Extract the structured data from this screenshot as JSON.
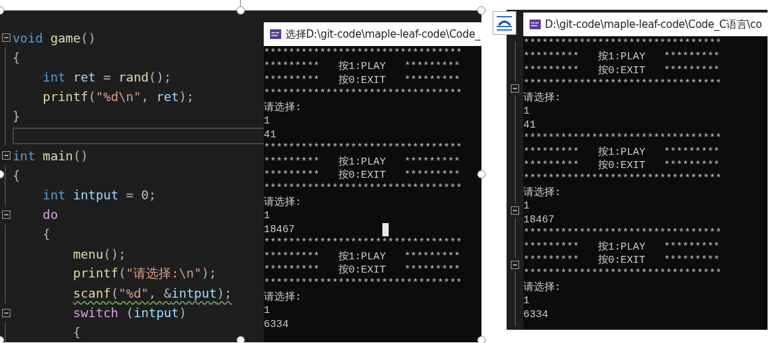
{
  "editor": {
    "lines": [
      {
        "collapsible": true,
        "current": false,
        "warning": false,
        "tokens": [
          {
            "text": "void",
            "kind": "type"
          },
          {
            "text": " game",
            "kind": "func"
          },
          {
            "text": "()",
            "kind": "punct"
          }
        ]
      },
      {
        "collapsible": false,
        "current": false,
        "warning": false,
        "tokens": [
          {
            "text": "{",
            "kind": "punct"
          }
        ]
      },
      {
        "collapsible": false,
        "current": false,
        "warning": false,
        "tokens": [
          {
            "text": "    int",
            "kind": "type"
          },
          {
            "text": " ret",
            "kind": "ident"
          },
          {
            "text": " = ",
            "kind": "punct"
          },
          {
            "text": "rand",
            "kind": "func"
          },
          {
            "text": "();",
            "kind": "punct"
          }
        ]
      },
      {
        "collapsible": false,
        "current": false,
        "warning": false,
        "tokens": [
          {
            "text": "    printf",
            "kind": "func"
          },
          {
            "text": "(",
            "kind": "punct"
          },
          {
            "text": "\"%d\\n\"",
            "kind": "string"
          },
          {
            "text": ", ",
            "kind": "punct"
          },
          {
            "text": "ret",
            "kind": "ident"
          },
          {
            "text": ");",
            "kind": "punct"
          }
        ]
      },
      {
        "collapsible": false,
        "current": false,
        "warning": false,
        "tokens": [
          {
            "text": "}",
            "kind": "punct"
          }
        ]
      },
      {
        "collapsible": false,
        "current": true,
        "warning": false
      },
      {
        "collapsible": true,
        "current": false,
        "warning": false,
        "tokens": [
          {
            "text": "int",
            "kind": "type"
          },
          {
            "text": " main",
            "kind": "func"
          },
          {
            "text": "()",
            "kind": "punct"
          }
        ]
      },
      {
        "collapsible": false,
        "current": false,
        "warning": false,
        "tokens": [
          {
            "text": "{",
            "kind": "punct"
          }
        ]
      },
      {
        "collapsible": false,
        "current": false,
        "warning": false,
        "tokens": [
          {
            "text": "    int",
            "kind": "type"
          },
          {
            "text": " intput",
            "kind": "ident"
          },
          {
            "text": " = ",
            "kind": "punct"
          },
          {
            "text": "0",
            "kind": "number"
          },
          {
            "text": ";",
            "kind": "punct"
          }
        ]
      },
      {
        "collapsible": true,
        "current": false,
        "warning": false,
        "tokens": [
          {
            "text": "    do",
            "kind": "control"
          }
        ]
      },
      {
        "collapsible": false,
        "current": false,
        "warning": false,
        "tokens": [
          {
            "text": "    {",
            "kind": "punct"
          }
        ]
      },
      {
        "collapsible": false,
        "current": false,
        "warning": false,
        "tokens": [
          {
            "text": "        menu",
            "kind": "func"
          },
          {
            "text": "();",
            "kind": "punct"
          }
        ]
      },
      {
        "collapsible": false,
        "current": false,
        "warning": false,
        "tokens": [
          {
            "text": "        printf",
            "kind": "func"
          },
          {
            "text": "(",
            "kind": "punct"
          },
          {
            "text": "\"请选择:\\n\"",
            "kind": "string"
          },
          {
            "text": ");",
            "kind": "punct"
          }
        ]
      },
      {
        "collapsible": false,
        "current": false,
        "warning": true,
        "tokens": [
          {
            "text": "        scanf",
            "kind": "func"
          },
          {
            "text": "(",
            "kind": "punct"
          },
          {
            "text": "\"%d\"",
            "kind": "string"
          },
          {
            "text": ", &",
            "kind": "punct"
          },
          {
            "text": "intput",
            "kind": "ident"
          },
          {
            "text": ");",
            "kind": "punct"
          }
        ]
      },
      {
        "collapsible": true,
        "current": false,
        "warning": false,
        "tokens": [
          {
            "text": "        switch",
            "kind": "control"
          },
          {
            "text": " (",
            "kind": "punct"
          },
          {
            "text": "intput",
            "kind": "ident"
          },
          {
            "text": ")",
            "kind": "punct"
          }
        ]
      },
      {
        "collapsible": false,
        "current": false,
        "warning": false,
        "tokens": [
          {
            "text": "        {",
            "kind": "punct"
          }
        ]
      }
    ]
  },
  "console_left": {
    "title": "选择D:\\git-code\\maple-leaf-code\\Code_",
    "lines": [
      {
        "text": "********************************",
        "cursor": false
      },
      {
        "text": "*********   按1:PLAY   *********",
        "cursor": false
      },
      {
        "text": "*********   按0:EXIT   *********",
        "cursor": false
      },
      {
        "text": "********************************",
        "cursor": false
      },
      {
        "text": "请选择:",
        "cursor": false
      },
      {
        "text": "1",
        "cursor": false
      },
      {
        "text": "41",
        "cursor": false
      },
      {
        "text": "********************************",
        "cursor": false
      },
      {
        "text": "*********   按1:PLAY   *********",
        "cursor": false
      },
      {
        "text": "*********   按0:EXIT   *********",
        "cursor": false
      },
      {
        "text": "********************************",
        "cursor": false
      },
      {
        "text": "请选择:",
        "cursor": false
      },
      {
        "text": "1",
        "cursor": false
      },
      {
        "text": "18467",
        "cursor": true
      },
      {
        "text": "********************************",
        "cursor": false
      },
      {
        "text": "*********   按1:PLAY   *********",
        "cursor": false
      },
      {
        "text": "*********   按0:EXIT   *********",
        "cursor": false
      },
      {
        "text": "********************************",
        "cursor": false
      },
      {
        "text": "请选择:",
        "cursor": false
      },
      {
        "text": "1",
        "cursor": false
      },
      {
        "text": "6334",
        "cursor": false
      }
    ]
  },
  "console_right": {
    "title": "D:\\git-code\\maple-leaf-code\\Code_C语言\\co",
    "lines": [
      {
        "text": "********************************",
        "gutter_fold": false
      },
      {
        "text": "*********   按1:PLAY   *********",
        "gutter_fold": false
      },
      {
        "text": "*********   按0:EXIT   *********",
        "gutter_fold": false
      },
      {
        "text": "********************************",
        "gutter_fold": true
      },
      {
        "text": "请选择:",
        "gutter_fold": false
      },
      {
        "text": "1",
        "gutter_fold": false
      },
      {
        "text": "41",
        "gutter_fold": false
      },
      {
        "text": "********************************",
        "gutter_fold": false
      },
      {
        "text": "*********   按1:PLAY   *********",
        "gutter_fold": false
      },
      {
        "text": "*********   按0:EXIT   *********",
        "gutter_fold": false
      },
      {
        "text": "********************************",
        "gutter_fold": false
      },
      {
        "text": "请选择:",
        "gutter_fold": false
      },
      {
        "text": "1",
        "gutter_fold": true
      },
      {
        "text": "18467",
        "gutter_fold": false
      },
      {
        "text": "********************************",
        "gutter_fold": false
      },
      {
        "text": "*********   按1:PLAY   *********",
        "gutter_fold": false
      },
      {
        "text": "*********   按0:EXIT   *********",
        "gutter_fold": true
      },
      {
        "text": "********************************",
        "gutter_fold": false
      },
      {
        "text": "请选择:",
        "gutter_fold": false
      },
      {
        "text": "1",
        "gutter_fold": false
      },
      {
        "text": "6334",
        "gutter_fold": false
      }
    ]
  }
}
